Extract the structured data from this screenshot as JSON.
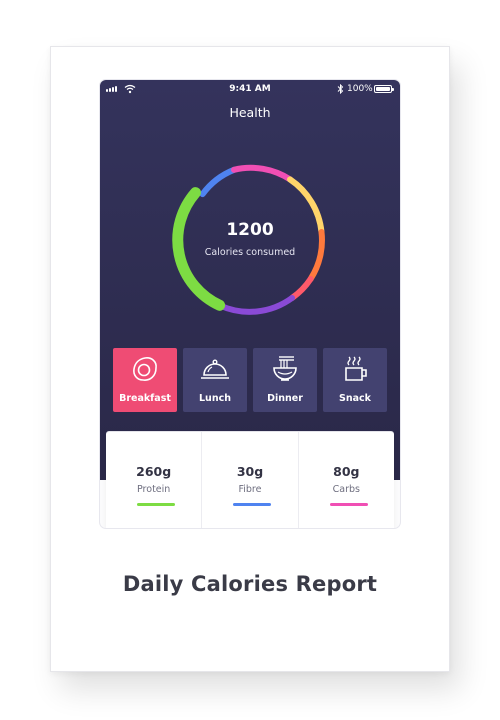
{
  "status_bar": {
    "time": "9:41 AM",
    "battery": "100%"
  },
  "header": {
    "title": "Health"
  },
  "calories": {
    "value": "1200",
    "label": "Calories consumed"
  },
  "meals": [
    {
      "label": "Breakfast",
      "icon": "fried-egg-icon",
      "active": true
    },
    {
      "label": "Lunch",
      "icon": "cloche-icon",
      "active": false
    },
    {
      "label": "Dinner",
      "icon": "noodle-bowl-icon",
      "active": false
    },
    {
      "label": "Snack",
      "icon": "hot-cup-icon",
      "active": false
    }
  ],
  "macros": [
    {
      "value": "260g",
      "label": "Protein",
      "color": "#7ddc43"
    },
    {
      "value": "30g",
      "label": "Fibre",
      "color": "#4f83f0"
    },
    {
      "value": "80g",
      "label": "Carbs",
      "color": "#f04fb4"
    }
  ],
  "ring_colors": {
    "green": "#7ddc43",
    "blue": "#4f83f0",
    "pink": "#f04fb4",
    "yellow": "#ffd56a",
    "orange": "#ff7a3d",
    "red": "#ff5a6a",
    "purple": "#8a4ad6"
  },
  "caption": "Daily Calories Report"
}
